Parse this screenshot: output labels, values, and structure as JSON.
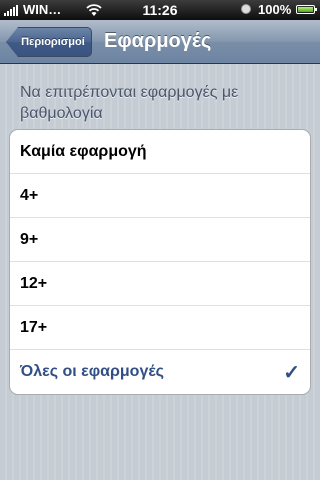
{
  "status_bar": {
    "carrier": "WIN…",
    "time": "11:26",
    "battery_percent": "100%"
  },
  "nav": {
    "back_label": "Περιορισμοί",
    "title": "Εφαρμογές"
  },
  "section_header": "Να επιτρέπονται εφαρμογές με βαθμολογία",
  "options": [
    {
      "label": "Καμία εφαρμογή",
      "selected": false
    },
    {
      "label": "4+",
      "selected": false
    },
    {
      "label": "9+",
      "selected": false
    },
    {
      "label": "12+",
      "selected": false
    },
    {
      "label": "17+",
      "selected": false
    },
    {
      "label": "Όλες οι εφαρμογές",
      "selected": true
    }
  ],
  "check_glyph": "✓",
  "colors": {
    "accent": "#324f85",
    "background": "#c5ccd4",
    "navbar": "#6d84a2"
  }
}
